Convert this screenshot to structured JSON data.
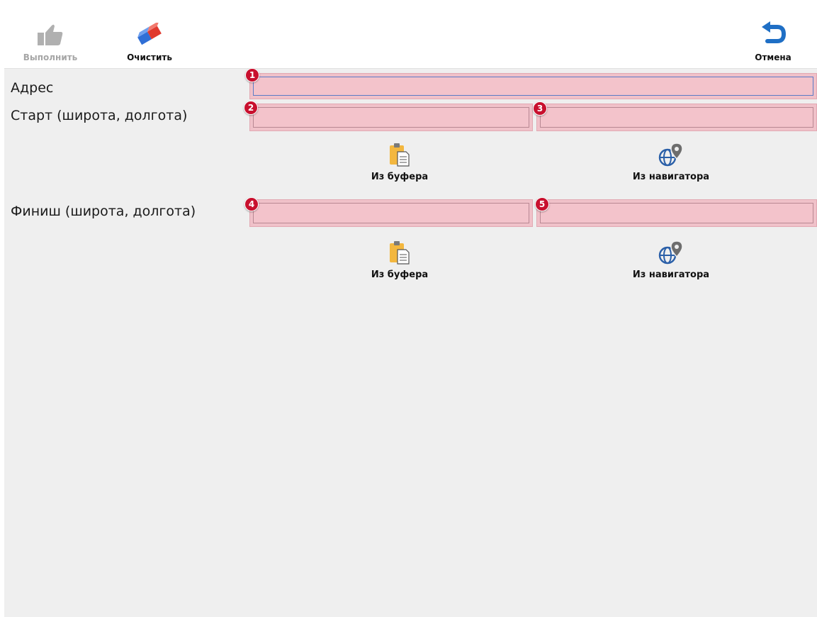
{
  "toolbar": {
    "execute_label": "Выполнить",
    "execute_icon": "thumbs-up-icon",
    "clear_label": "Очистить",
    "clear_icon": "eraser-icon",
    "cancel_label": "Отмена",
    "cancel_icon": "undo-arrow-icon"
  },
  "form": {
    "address": {
      "label": "Адрес",
      "value": "",
      "badge": "1"
    },
    "start": {
      "label": "Старт (широта, долгота)",
      "lat": {
        "value": "",
        "badge": "2"
      },
      "lon": {
        "value": "",
        "badge": "3"
      },
      "clipboard_label": "Из буфера",
      "navigator_label": "Из навигатора"
    },
    "finish": {
      "label": "Финиш (широта, долгота)",
      "lat": {
        "value": "",
        "badge": "4"
      },
      "lon": {
        "value": "",
        "badge": "5"
      },
      "clipboard_label": "Из буфера",
      "navigator_label": "Из навигатора"
    }
  },
  "colors": {
    "field_fill": "#f3c3cb",
    "badge": "#c8102e",
    "accent_blue": "#1f6fc5",
    "clipboard_yellow": "#f3b73f"
  }
}
